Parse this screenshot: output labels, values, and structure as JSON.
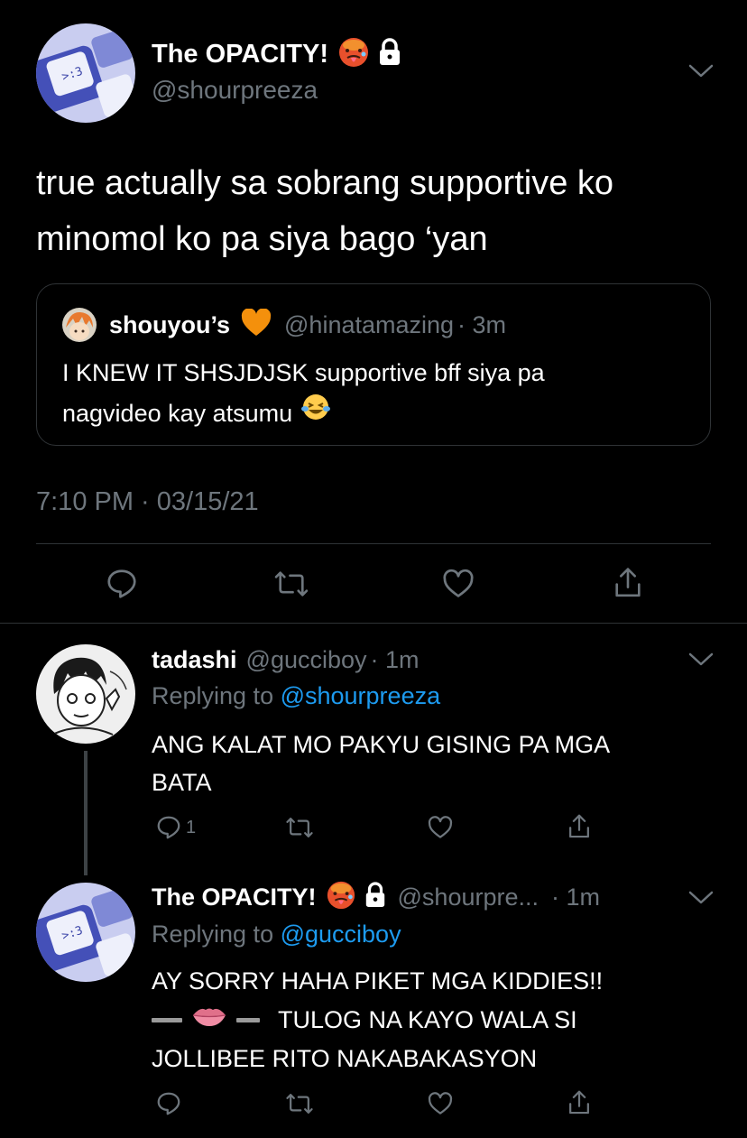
{
  "main_tweet": {
    "display_name": "The OPACITY!",
    "handle": "@shourpreeza",
    "text_line1": "true actually sa sobrang supportive ko",
    "text_line2": "minomol ko pa siya bago ‘yan",
    "timestamp": "7:10 PM · 03/15/21",
    "quote": {
      "display_name": "shouyou’s",
      "handle": "@hinatamazing",
      "time": "· 3m",
      "text_line1": "I KNEW IT SHSJDJSK supportive bff siya pa",
      "text_line2": "nagvideo kay atsumu"
    }
  },
  "replies": [
    {
      "display_name": "tadashi",
      "handle": "@gucciboy",
      "time": "· 1m",
      "replying_prefix": "Replying to ",
      "replying_to": "@shourpreeza",
      "text_line1": "ANG KALAT MO PAKYU GISING PA MGA",
      "text_line2": "BATA",
      "reply_count": "1"
    },
    {
      "display_name": "The OPACITY!",
      "handle": "@shourpre...",
      "time": "· 1m",
      "replying_prefix": "Replying to ",
      "replying_to": "@gucciboy",
      "text_line1": "AY SORRY HAHA PIKET MGA KIDDIES!!",
      "text_line2_suffix": "TULOG NA KAYO WALA SI",
      "text_line3": "JOLLIBEE RITO NAKABAKASYON"
    }
  ],
  "colors": {
    "background": "#000000",
    "text": "#ffffff",
    "muted": "#6e767d",
    "link": "#1d9bf0",
    "divider": "#2f3336",
    "heart_emoji": "#f4900c"
  },
  "icons": [
    "hot-face-emoji",
    "lock-icon",
    "chevron-down-icon",
    "orange-heart-emoji",
    "laughing-tears-emoji",
    "lips-emoji",
    "reply-icon",
    "retweet-icon",
    "like-icon",
    "share-icon"
  ]
}
